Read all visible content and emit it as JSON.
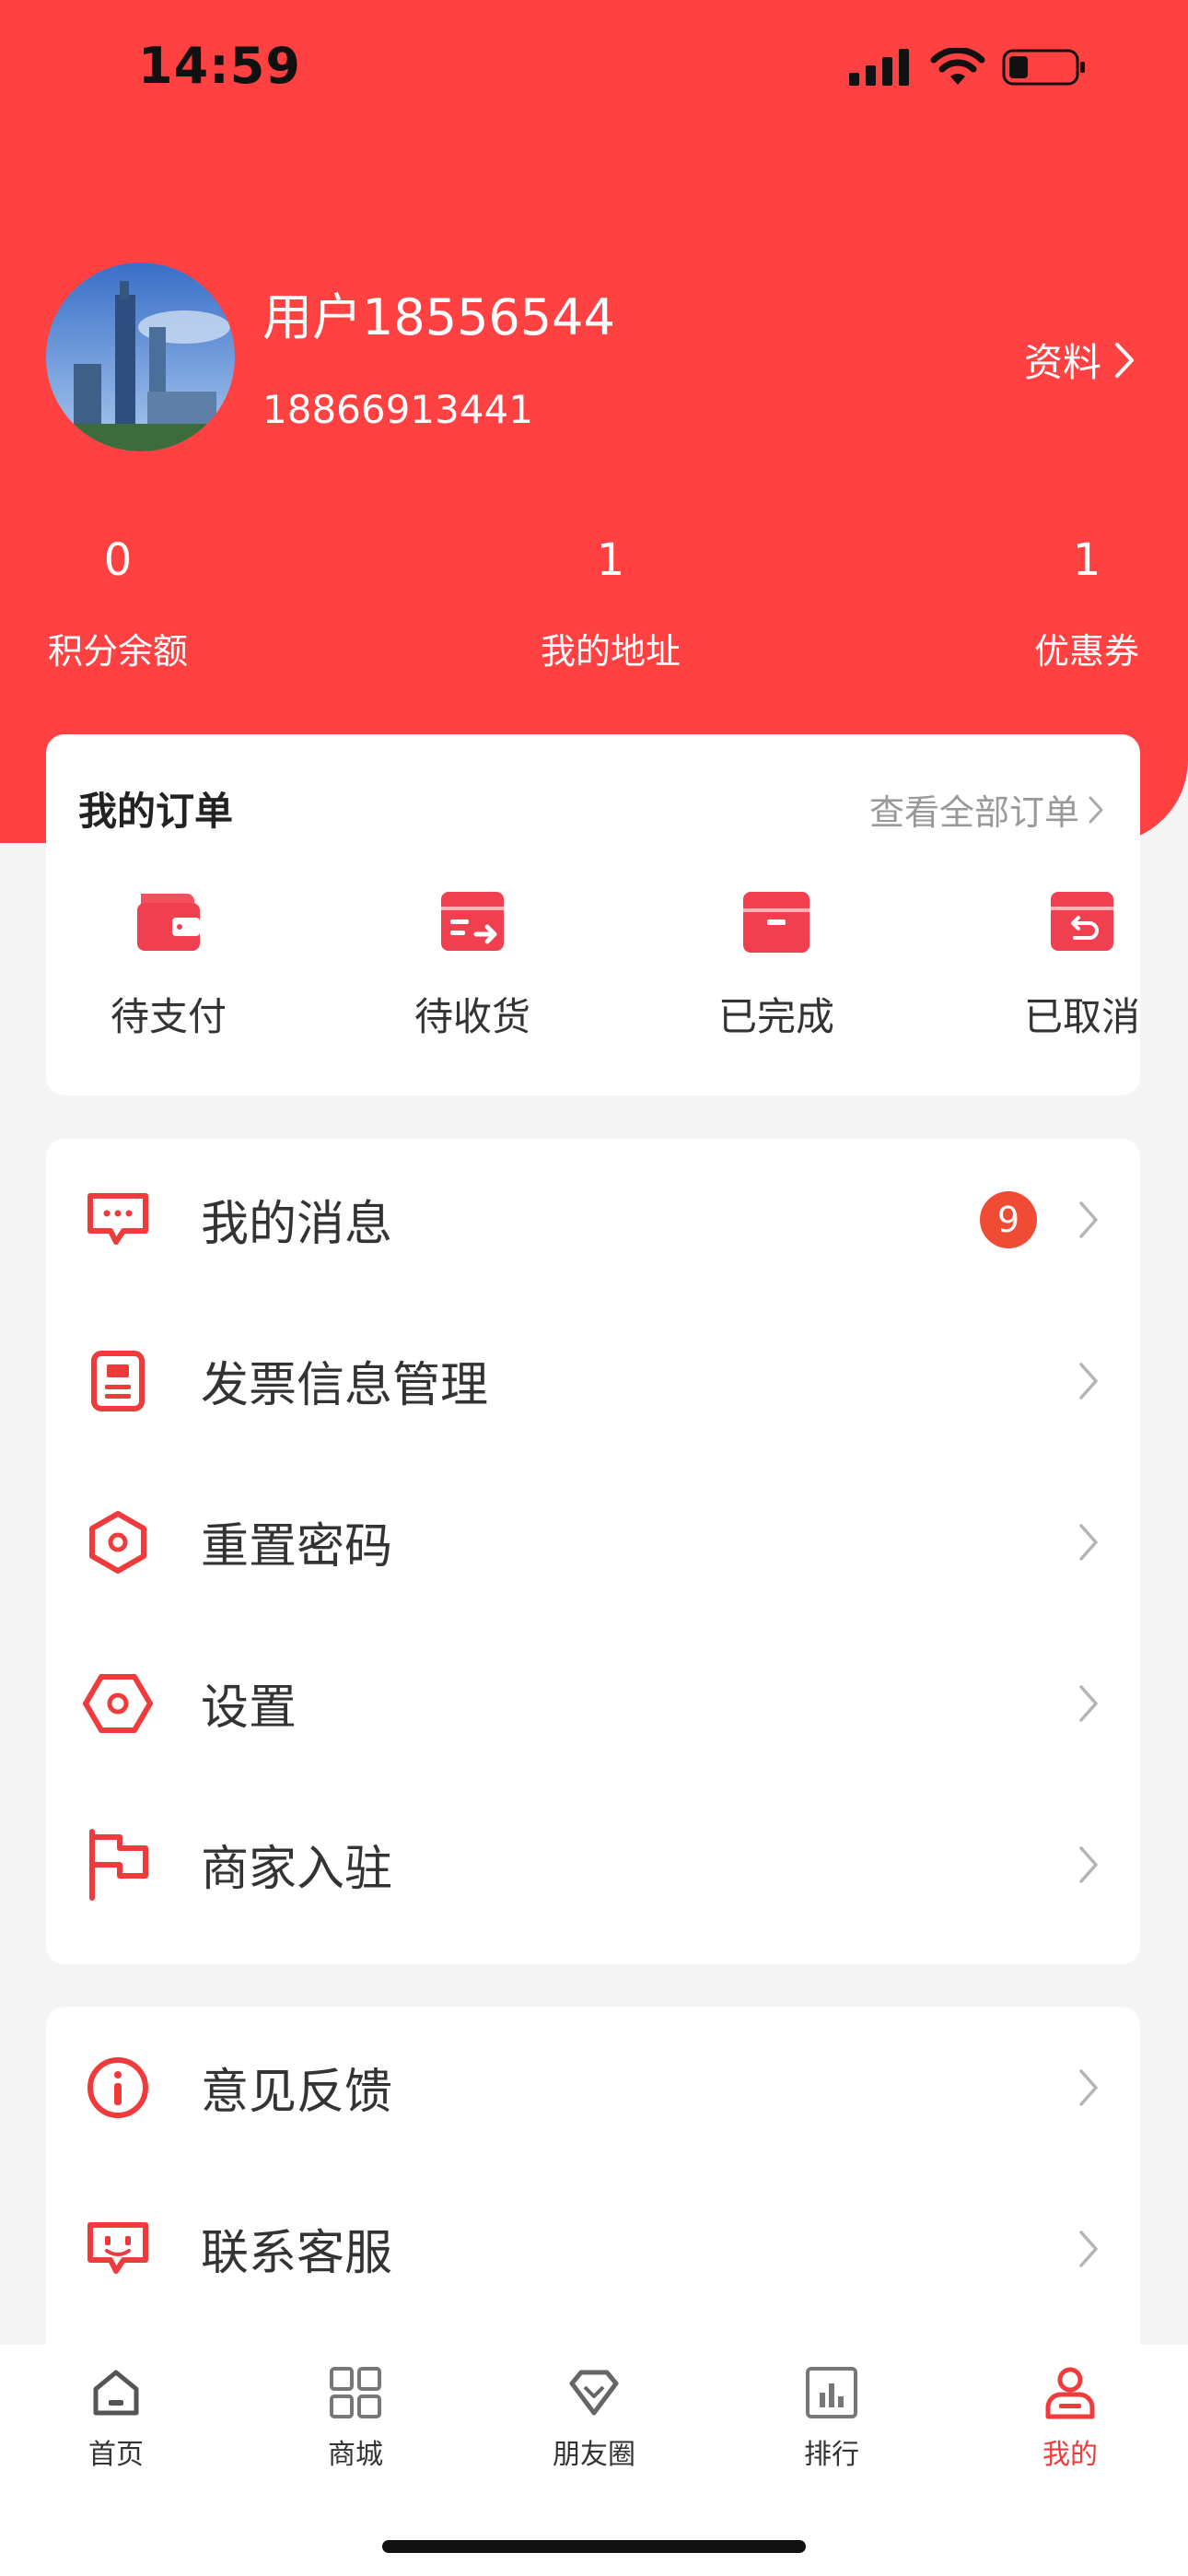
{
  "status_bar": {
    "time": "14:59"
  },
  "profile": {
    "username": "用户18556544",
    "phone": "18866913441",
    "link_label": "资料"
  },
  "stats": [
    {
      "value": "0",
      "label": "积分余额"
    },
    {
      "value": "1",
      "label": "我的地址"
    },
    {
      "value": "1",
      "label": "优惠券"
    }
  ],
  "orders": {
    "title": "我的订单",
    "view_all": "查看全部订单",
    "items": [
      {
        "label": "待支付",
        "icon": "wallet-icon"
      },
      {
        "label": "待收货",
        "icon": "receive-box-icon"
      },
      {
        "label": "已完成",
        "icon": "box-icon"
      },
      {
        "label": "已取消",
        "icon": "return-box-icon"
      }
    ]
  },
  "menu": [
    {
      "label": "我的消息",
      "icon": "message-icon",
      "badge": "9"
    },
    {
      "label": "发票信息管理",
      "icon": "invoice-icon"
    },
    {
      "label": "重置密码",
      "icon": "hexagon-icon"
    },
    {
      "label": "设置",
      "icon": "settings-hex-icon"
    },
    {
      "label": "商家入驻",
      "icon": "flag-icon"
    }
  ],
  "menu2": [
    {
      "label": "意见反馈",
      "icon": "info-icon"
    },
    {
      "label": "联系客服",
      "icon": "customer-service-icon"
    }
  ],
  "tabbar": [
    {
      "label": "首页",
      "icon": "home-icon"
    },
    {
      "label": "商城",
      "icon": "grid-icon"
    },
    {
      "label": "朋友圈",
      "icon": "diamond-icon"
    },
    {
      "label": "排行",
      "icon": "chart-icon"
    },
    {
      "label": "我的",
      "icon": "user-icon",
      "active": true
    }
  ],
  "colors": {
    "primary": "#ff4141",
    "accent_red": "#ef3b3b",
    "badge": "#f04c35"
  }
}
